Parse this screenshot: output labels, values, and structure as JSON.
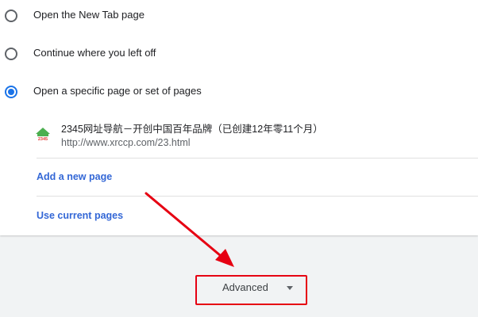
{
  "startup": {
    "options": [
      {
        "label": "Open the New Tab page",
        "selected": false
      },
      {
        "label": "Continue where you left off",
        "selected": false
      },
      {
        "label": "Open a specific page or set of pages",
        "selected": true
      }
    ],
    "pages": [
      {
        "title": "2345网址导航－开创中国百年品牌（已创建12年零11个月）",
        "url": "http://www.xrccp.com/23.html",
        "favicon": "2345-favicon"
      }
    ],
    "add_page_label": "Add a new page",
    "use_current_label": "Use current pages"
  },
  "advanced": {
    "label": "Advanced",
    "icon": "caret-down-icon"
  },
  "annotation": {
    "arrow_color": "#e60012",
    "box_color": "#e60012"
  },
  "colors": {
    "accent": "#1a73e8",
    "link": "#3367d6",
    "background": "#f1f3f4"
  }
}
